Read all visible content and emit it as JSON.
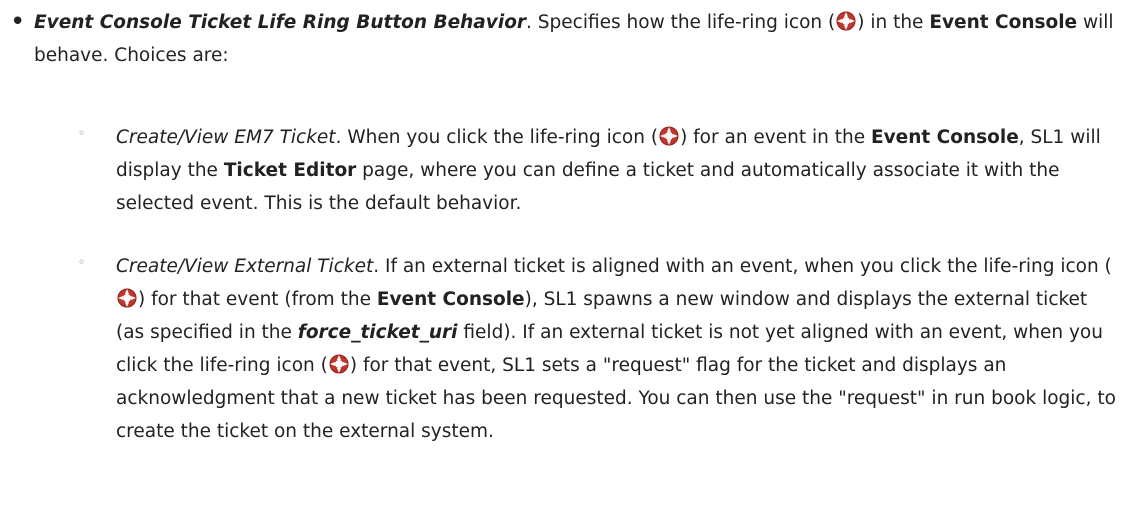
{
  "icon": {
    "name": "life-ring-icon",
    "color_outer": "#c0362c",
    "color_white": "#ffffff"
  },
  "top": {
    "title": "Event Console Ticket Life Ring Button Behavior",
    "t1": ". Specifies how the life-ring icon (",
    "t2": ") in the ",
    "event_console": "Event Console",
    "t3": " will behave. Choices are:"
  },
  "option1": {
    "title": "Create/View EM7 Ticket",
    "t1": ". When you click the life-ring icon (",
    "t2": ") for an event in the ",
    "event_console": "Event Console",
    "t3": ", SL1 will display the ",
    "ticket_editor": "Ticket Editor",
    "t4": " page, where you can define a ticket and automatically associate it with the selected event. This is the default behavior."
  },
  "option2": {
    "title": "Create/View External Ticket",
    "t1": ". If an external ticket is aligned with an event, when you click the life-ring icon (",
    "t2": ") for that event (from the ",
    "event_console": "Event Console",
    "t3": "), SL1 spawns a new window and displays the external ticket (as specified in the ",
    "field": "force_ticket_uri",
    "t4": " field). If an external ticket is not yet aligned with an event, when you click the life-ring icon (",
    "t5": ") for that event, SL1 sets a \"request\" flag for the ticket and displays an acknowledgment that a new ticket has been requested. You can then use the \"request\" in run book logic, to create the ticket on the external system."
  }
}
